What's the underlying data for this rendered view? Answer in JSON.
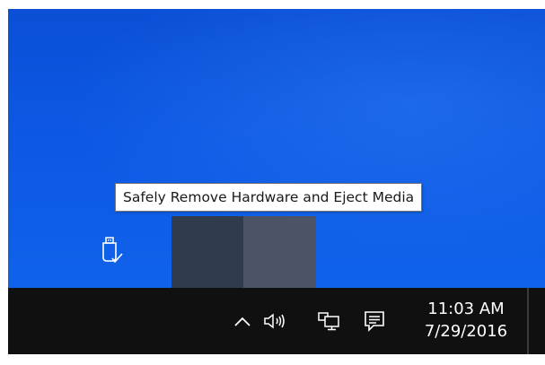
{
  "tooltip": {
    "text": "Safely Remove Hardware and Eject Media"
  },
  "flyout": {
    "items": [
      {
        "icon": "empty-slot"
      },
      {
        "icon": "usb-eject-icon"
      }
    ]
  },
  "taskbar": {
    "tray_icons": [
      "chevron-up-icon",
      "volume-icon",
      "network-icon",
      "action-center-icon"
    ],
    "clock": {
      "time": "11:03 AM",
      "date": "7/29/2016"
    }
  },
  "colors": {
    "desktop": "#0d58e3",
    "taskbar": "#101010",
    "flyout": "#303b4e",
    "flyout_hover": "#4a5466",
    "tooltip_bg": "#ffffff",
    "tooltip_border": "#767676"
  }
}
